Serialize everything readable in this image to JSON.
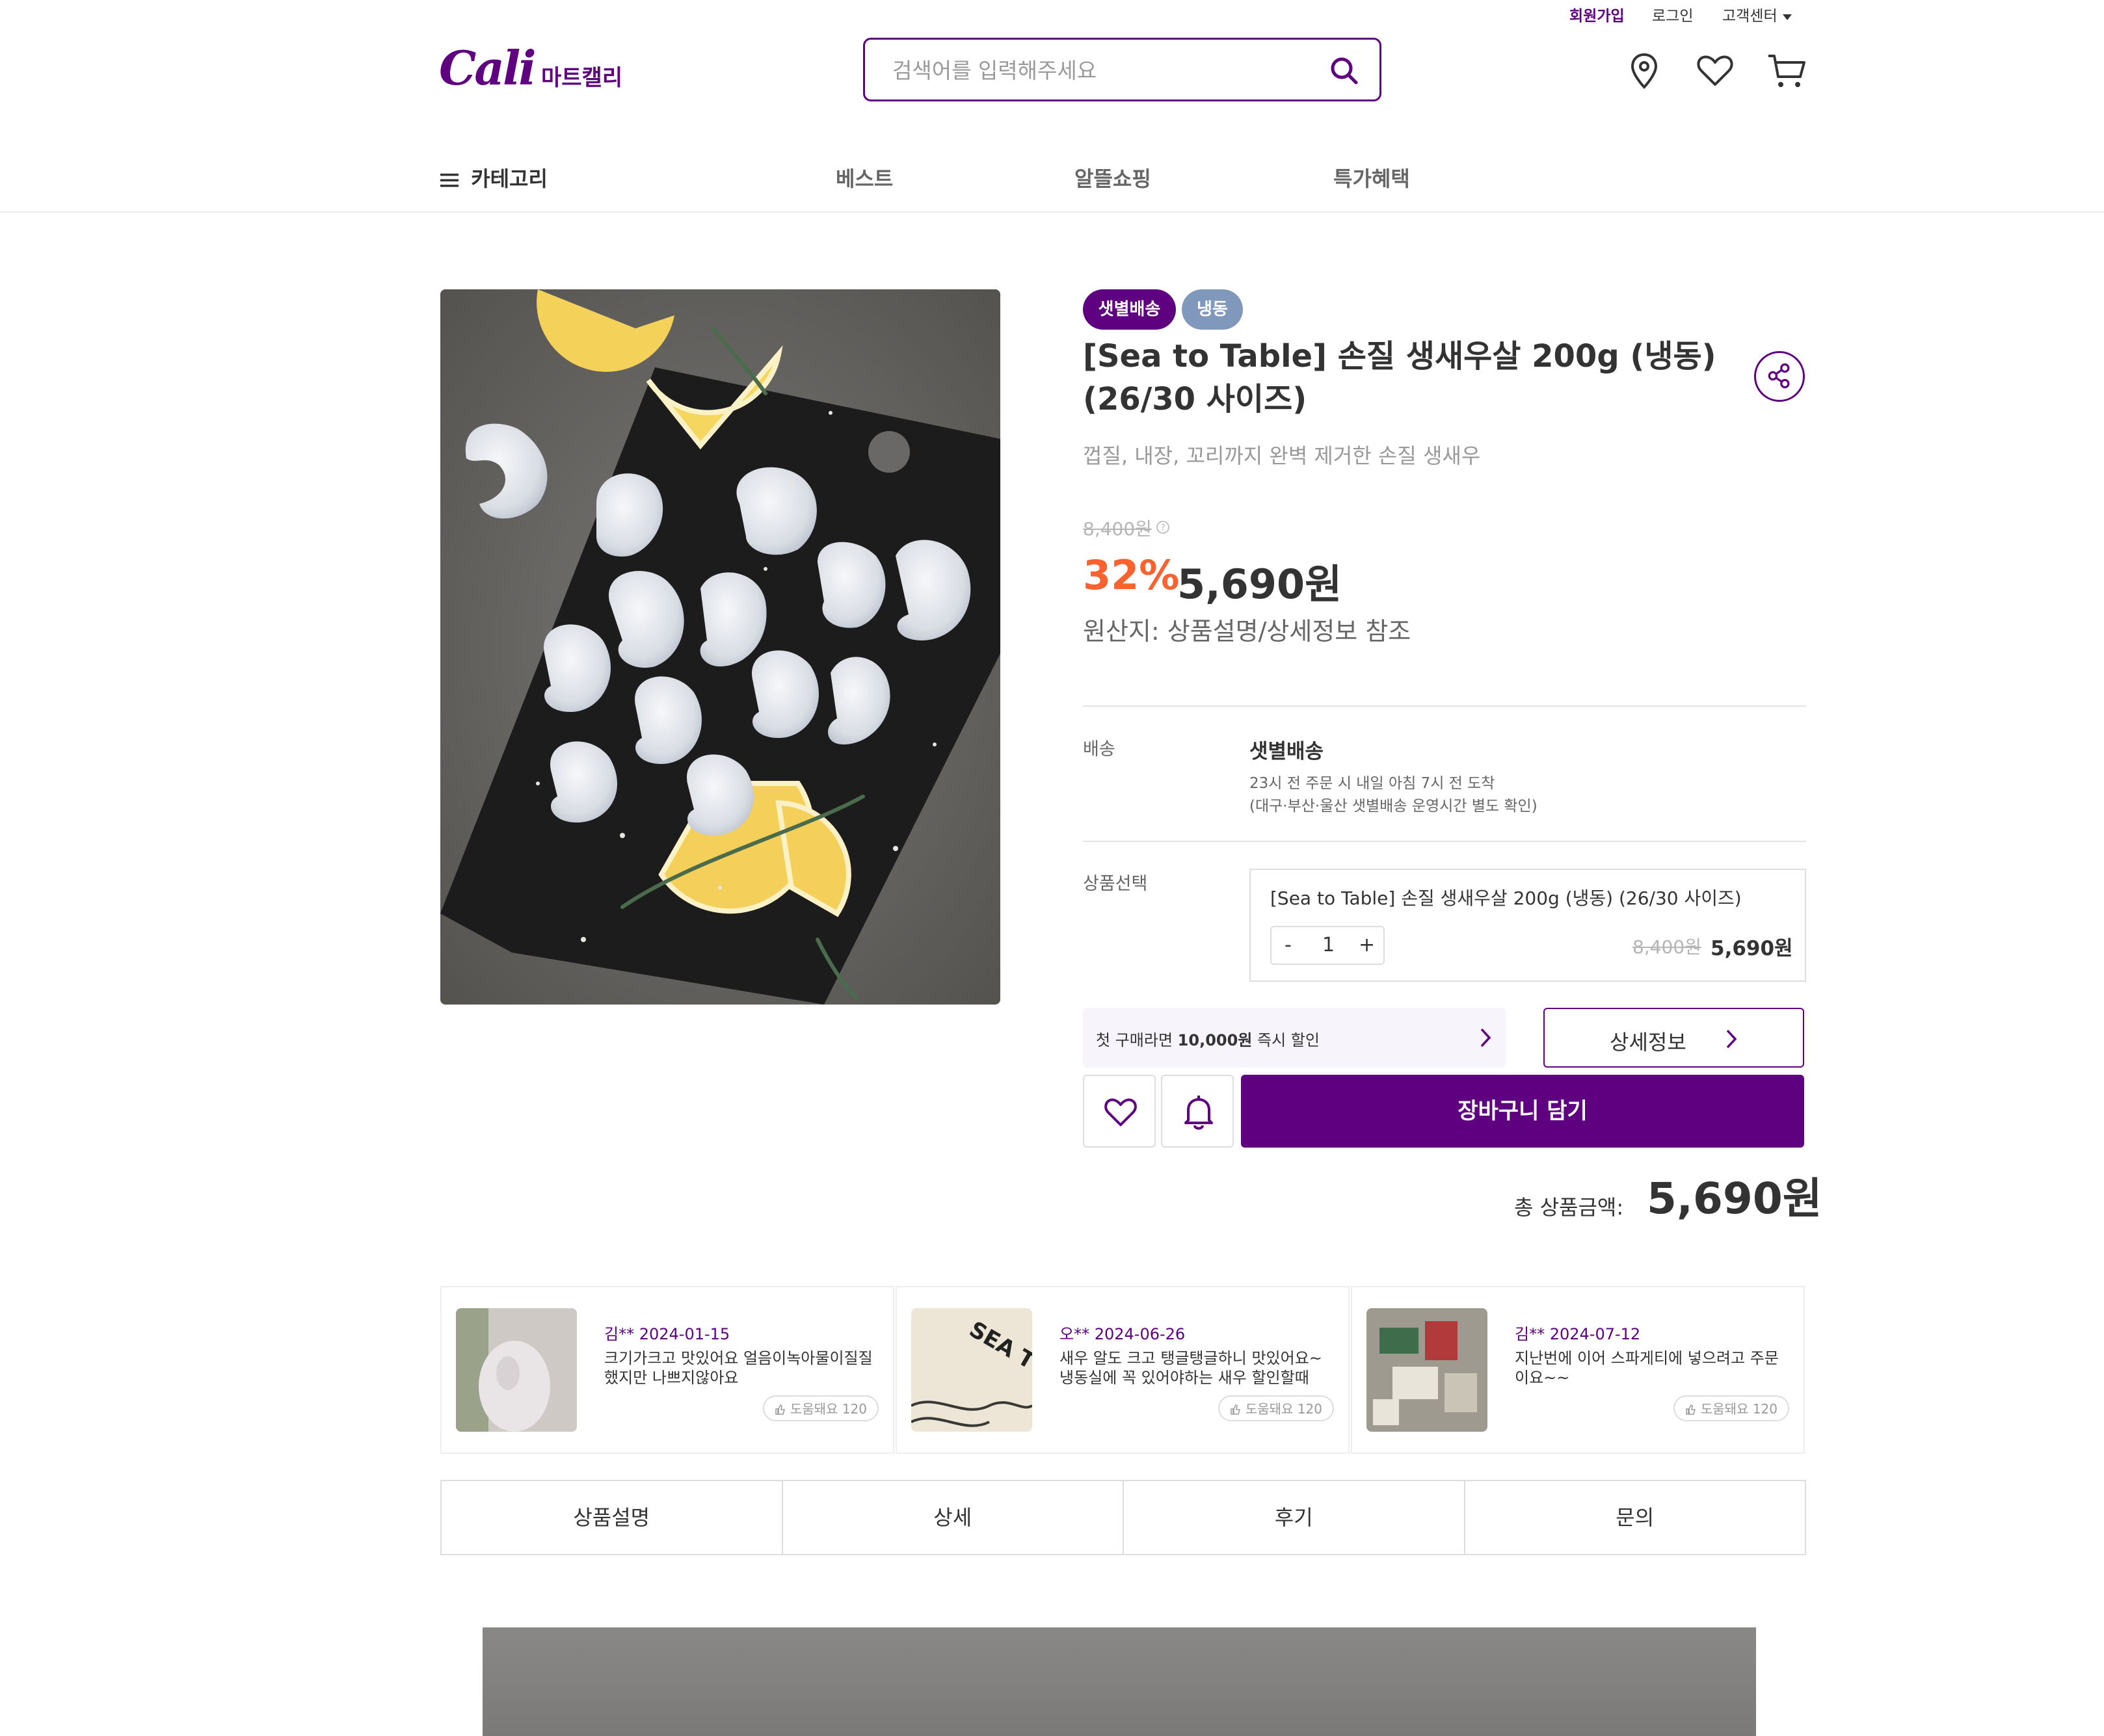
{
  "header": {
    "top_links": [
      "회원가입",
      "로그인",
      "고객센터"
    ],
    "logo": "Cali",
    "logo_sub": "마트캘리",
    "search_placeholder": "검색어를 입력해주세요",
    "icons": [
      "location-icon",
      "heart-icon",
      "cart-icon"
    ]
  },
  "nav": {
    "category": "카테고리",
    "items": [
      "베스트",
      "알뜰쇼핑",
      "특가혜택"
    ]
  },
  "product": {
    "badges": [
      "샛별배송",
      "냉동"
    ],
    "title": "[Sea to Table] 손질 생새우살 200g (냉동) (26/30 사이즈)",
    "subtitle": "껍질, 내장, 꼬리까지 완벽 제거한 손질 생새우",
    "original_price": "8,400원",
    "discount": "32%",
    "price": "5,690원",
    "origin": "원산지: 상품설명/상세정보 참조"
  },
  "delivery": {
    "label": "배송",
    "type": "샛별배송",
    "line1": "23시 전 주문 시 내일 아침 7시 전 도착",
    "line2": "(대구·부산·울산 샛별배송 운영시간 별도 확인)"
  },
  "option": {
    "label": "상품선택",
    "name": "[Sea to Table] 손질 생새우살 200g (냉동) (26/30 사이즈)",
    "minus": "-",
    "qty": "1",
    "plus": "+",
    "original_price": "8,400원",
    "price": "5,690원"
  },
  "coupon": {
    "prefix": "첫 구매라면 ",
    "amount": "10,000원",
    "suffix": " 즉시 할인"
  },
  "detail_button": "상세정보",
  "cart_button": "장바구니 담기",
  "total": {
    "label": "총 상품금액:",
    "value": "5,690원"
  },
  "reviews": [
    {
      "author": "김** 2024-01-15",
      "text": "크기가크고 맛있어요 얼음이녹아물이질질 했지만 나쁘지않아요",
      "helpful": "도움돼요 120"
    },
    {
      "author": "오** 2024-06-26",
      "text": "새우 알도 크고 탱글탱글하니 맛있어요~ 냉동실에 꼭 있어야하는 새우 할인할때",
      "helpful": "도움돼요 120",
      "image_text": "SEA TO TABLE"
    },
    {
      "author": "김** 2024-07-12",
      "text": "지난번에 이어 스파게티에 넣으려고 주문이요~~",
      "helpful": "도움돼요 120"
    }
  ],
  "tabs": [
    "상품설명",
    "상세",
    "후기",
    "문의"
  ],
  "colors": {
    "brand": "#5f0080",
    "discount": "#fa622f",
    "badge_frozen": "#8198bd"
  }
}
